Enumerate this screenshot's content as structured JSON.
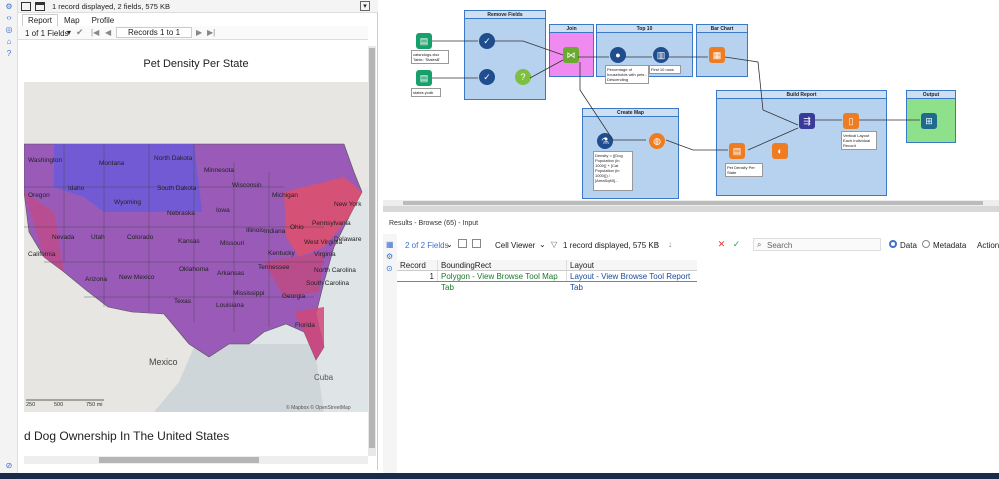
{
  "browse": {
    "status": "1 record displayed, 2 fields, 575 KB",
    "tabs": [
      "Report",
      "Map",
      "Profile"
    ],
    "fields_selector": "1 of 1 Fields",
    "records_label": "Records 1 to 1",
    "report_title": "Pet Density Per State",
    "report_footer": "d Dog Ownership In The United States",
    "map": {
      "country_labels": [
        "Mexico",
        "Cuba"
      ],
      "state_labels": [
        "Washington",
        "Montana",
        "North Dakota",
        "Minnesota",
        "Oregon",
        "Idaho",
        "South Dakota",
        "Wisconsin",
        "Michigan",
        "Wyoming",
        "Nebraska",
        "Iowa",
        "New York",
        "Pennsylvania",
        "Nevada",
        "Utah",
        "Colorado",
        "Kansas",
        "Illinois",
        "Indiana",
        "Ohio",
        "California",
        "Missouri",
        "West Virginia",
        "Virginia",
        "Delaware",
        "Kentucky",
        "Arizona",
        "New Mexico",
        "Oklahoma",
        "Arkansas",
        "Tennessee",
        "North Carolina",
        "South Carolina",
        "Texas",
        "Louisiana",
        "Mississippi",
        "Georgia",
        "Florida"
      ],
      "scale": [
        "250",
        "500",
        "750 mi"
      ],
      "attribution": "© Mapbox © OpenStreetMap"
    }
  },
  "workflow": {
    "containers": {
      "remove_fields": "Remove Fields",
      "join": "Join",
      "top10": "Top 10",
      "bar_chart": "Bar Chart",
      "create_map": "Create Map",
      "build_report": "Build Report",
      "output": "Output"
    },
    "annotations": {
      "input1": "catsndogs.xlsx Table: 'States$'",
      "input2": "states.yxdb",
      "sort": "Percentage of households with pets - Descending",
      "first10": "First 10 rows",
      "formula": "Density = ([Dog Population (in 1000)] + [Cat Population (in 1000)]) / [AreaSqMi]...",
      "map_title": "Pet Density Per State",
      "layout": "Vertical Layout Each Individual Record"
    }
  },
  "results": {
    "header": "Results - Browse (65) - Input",
    "fields": "2 of 2 Fields",
    "cell_viewer": "Cell Viewer",
    "status": "1 record displayed, 575 KB",
    "search_placeholder": "Search",
    "data_label": "Data",
    "metadata_label": "Metadata",
    "actions_label": "Actions",
    "columns": [
      "Record",
      "BoundingRect",
      "Layout"
    ],
    "rows": [
      [
        "1",
        "Polygon - View Browse Tool Map Tab",
        "Layout - View Browse Tool Report Tab"
      ]
    ]
  }
}
